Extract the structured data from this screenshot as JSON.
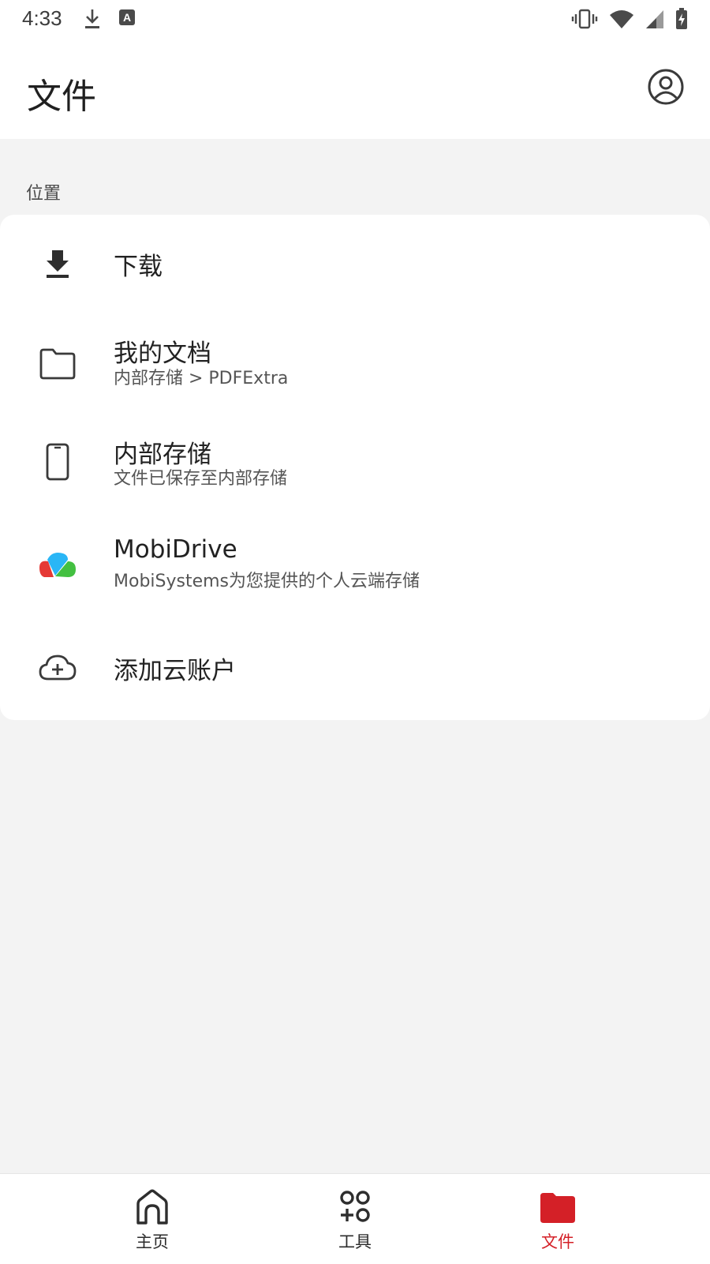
{
  "status_bar": {
    "time": "4:33",
    "left_icons": [
      "download-icon",
      "keyboard-a-icon"
    ],
    "right_icons": [
      "vibrate-icon",
      "wifi-icon",
      "signal-icon",
      "battery-charging-icon"
    ]
  },
  "app_bar": {
    "title": "文件",
    "account_icon": "account-circle-icon"
  },
  "section": {
    "label": "位置"
  },
  "locations": [
    {
      "title": "下载",
      "subtitle": "",
      "icon": "download-icon"
    },
    {
      "title": "我的文档",
      "subtitle": "内部存储 > PDFExtra",
      "icon": "folder-icon"
    },
    {
      "title": "内部存储",
      "subtitle": "文件已保存至内部存储",
      "icon": "phone-icon"
    },
    {
      "title": "MobiDrive",
      "subtitle": "MobiSystems为您提供的个人云端存储",
      "icon": "mobidrive-logo-icon"
    },
    {
      "title": "添加云账户",
      "subtitle": "",
      "icon": "cloud-add-icon"
    }
  ],
  "bottom_nav": [
    {
      "label": "主页",
      "icon": "home-icon",
      "active": false
    },
    {
      "label": "工具",
      "icon": "tools-icon",
      "active": false
    },
    {
      "label": "文件",
      "icon": "folder-filled-icon",
      "active": true
    }
  ],
  "colors": {
    "accent": "#d42027",
    "background": "#f3f3f3",
    "surface": "#ffffff",
    "icon": "#3a3a3a"
  }
}
